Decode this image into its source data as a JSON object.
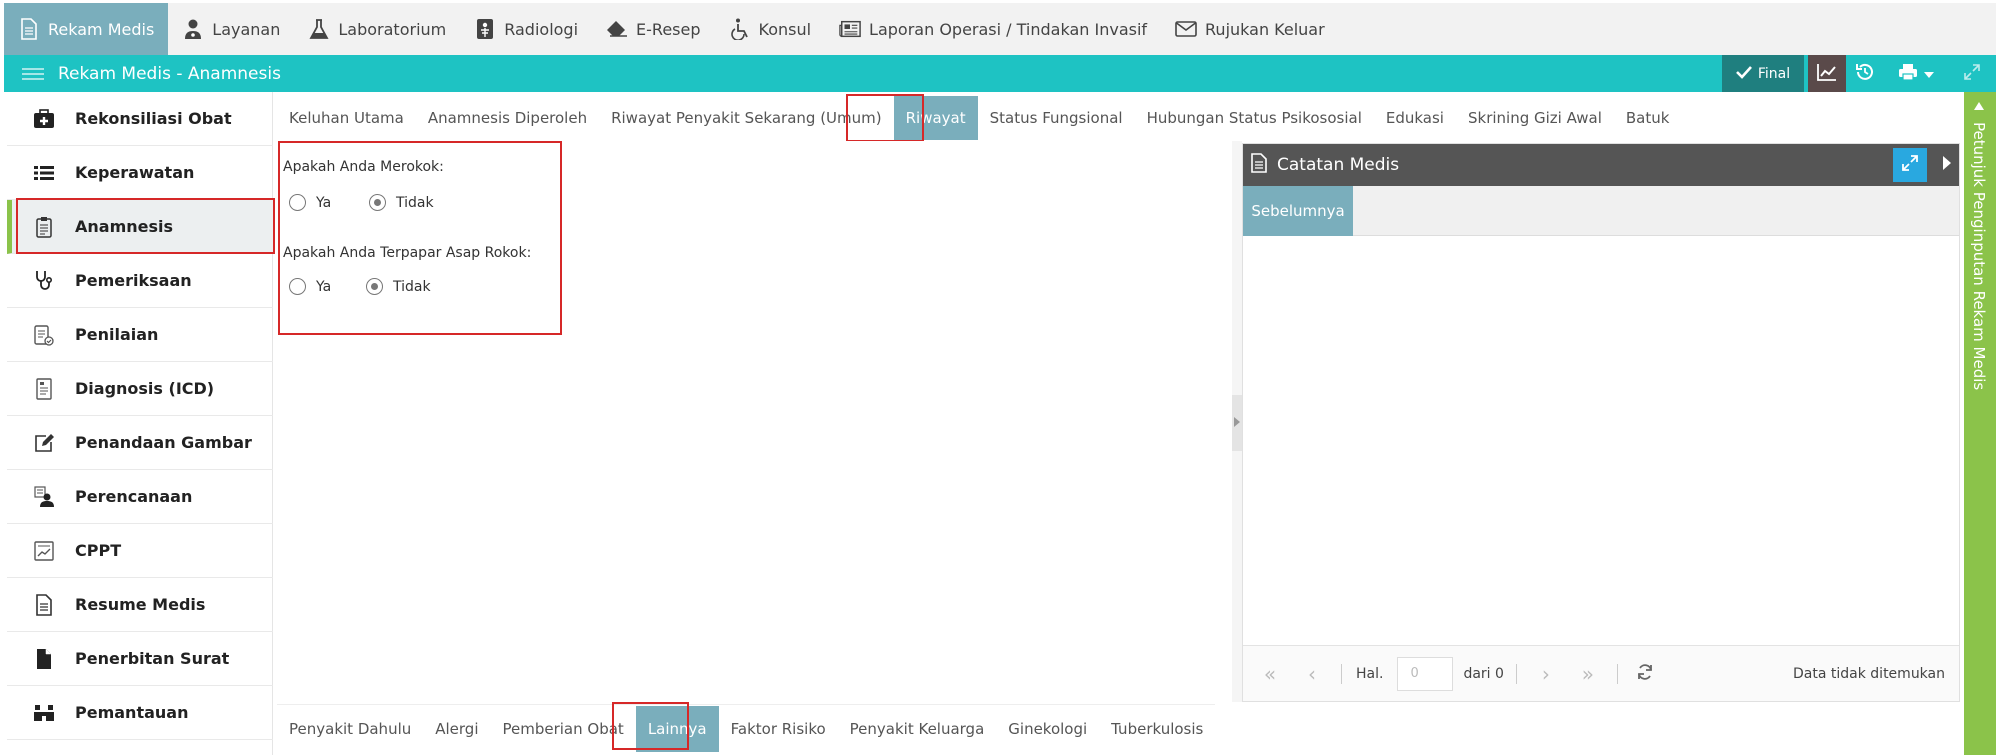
{
  "topnav": {
    "items": [
      {
        "label": "Rekam Medis",
        "icon": "document-icon",
        "active": true
      },
      {
        "label": "Layanan",
        "icon": "doctor-icon"
      },
      {
        "label": "Laboratorium",
        "icon": "flask-icon"
      },
      {
        "label": "Radiologi",
        "icon": "xray-icon"
      },
      {
        "label": "E-Resep",
        "icon": "eraser-icon"
      },
      {
        "label": "Konsul",
        "icon": "wheelchair-icon"
      },
      {
        "label": "Laporan Operasi / Tindakan Invasif",
        "icon": "newspaper-icon"
      },
      {
        "label": "Rujukan Keluar",
        "icon": "envelope-icon"
      }
    ]
  },
  "titlebar": {
    "title": "Rekam Medis - Anamnesis",
    "final_label": "Final"
  },
  "sidebar": {
    "items": [
      {
        "label": "Rekonsiliasi Obat",
        "icon": "medkit-icon"
      },
      {
        "label": "Keperawatan",
        "icon": "list-icon"
      },
      {
        "label": "Anamnesis",
        "icon": "clipboard-icon",
        "active": true
      },
      {
        "label": "Pemeriksaan",
        "icon": "stethoscope-icon"
      },
      {
        "label": "Penilaian",
        "icon": "checklist-icon"
      },
      {
        "label": "Diagnosis (ICD)",
        "icon": "report-icon"
      },
      {
        "label": "Penandaan Gambar",
        "icon": "edit-icon"
      },
      {
        "label": "Perencanaan",
        "icon": "user-plan-icon"
      },
      {
        "label": "CPPT",
        "icon": "chart-doc-icon"
      },
      {
        "label": "Resume Medis",
        "icon": "file-text-icon"
      },
      {
        "label": "Penerbitan Surat",
        "icon": "file-icon"
      },
      {
        "label": "Pemantauan",
        "icon": "binoculars-icon"
      }
    ]
  },
  "tabs_top": [
    {
      "label": "Keluhan Utama"
    },
    {
      "label": "Anamnesis Diperoleh"
    },
    {
      "label": "Riwayat Penyakit Sekarang (Umum)"
    },
    {
      "label": "Riwayat",
      "active": true
    },
    {
      "label": "Status Fungsional"
    },
    {
      "label": "Hubungan Status Psikososial"
    },
    {
      "label": "Edukasi"
    },
    {
      "label": "Skrining Gizi Awal"
    },
    {
      "label": "Batuk"
    }
  ],
  "form": {
    "q1": {
      "label": "Apakah Anda Merokok:",
      "opt_yes": "Ya",
      "opt_no": "Tidak",
      "selected": "Tidak"
    },
    "q2": {
      "label": "Apakah Anda Terpapar Asap Rokok:",
      "opt_yes": "Ya",
      "opt_no": "Tidak",
      "selected": "Tidak"
    }
  },
  "panel": {
    "title": "Catatan Medis",
    "tab_label": "Sebelumnya",
    "pager": {
      "hal_label": "Hal.",
      "page_placeholder": "0",
      "of_label": "dari 0",
      "status": "Data tidak ditemukan"
    }
  },
  "vtab": {
    "label": "Petunjuk Penginputan Rekam Medis"
  },
  "tabs_bottom": [
    {
      "label": "Penyakit Dahulu"
    },
    {
      "label": "Alergi"
    },
    {
      "label": "Pemberian Obat"
    },
    {
      "label": "Lainnya",
      "active": true
    },
    {
      "label": "Faktor Risiko"
    },
    {
      "label": "Penyakit Keluarga"
    },
    {
      "label": "Ginekologi"
    },
    {
      "label": "Tuberkulosis"
    }
  ],
  "colors": {
    "teal": "#1ec3c3",
    "active_tab": "#7aaebc",
    "green": "#8bc34a",
    "highlight": "#d62828"
  }
}
